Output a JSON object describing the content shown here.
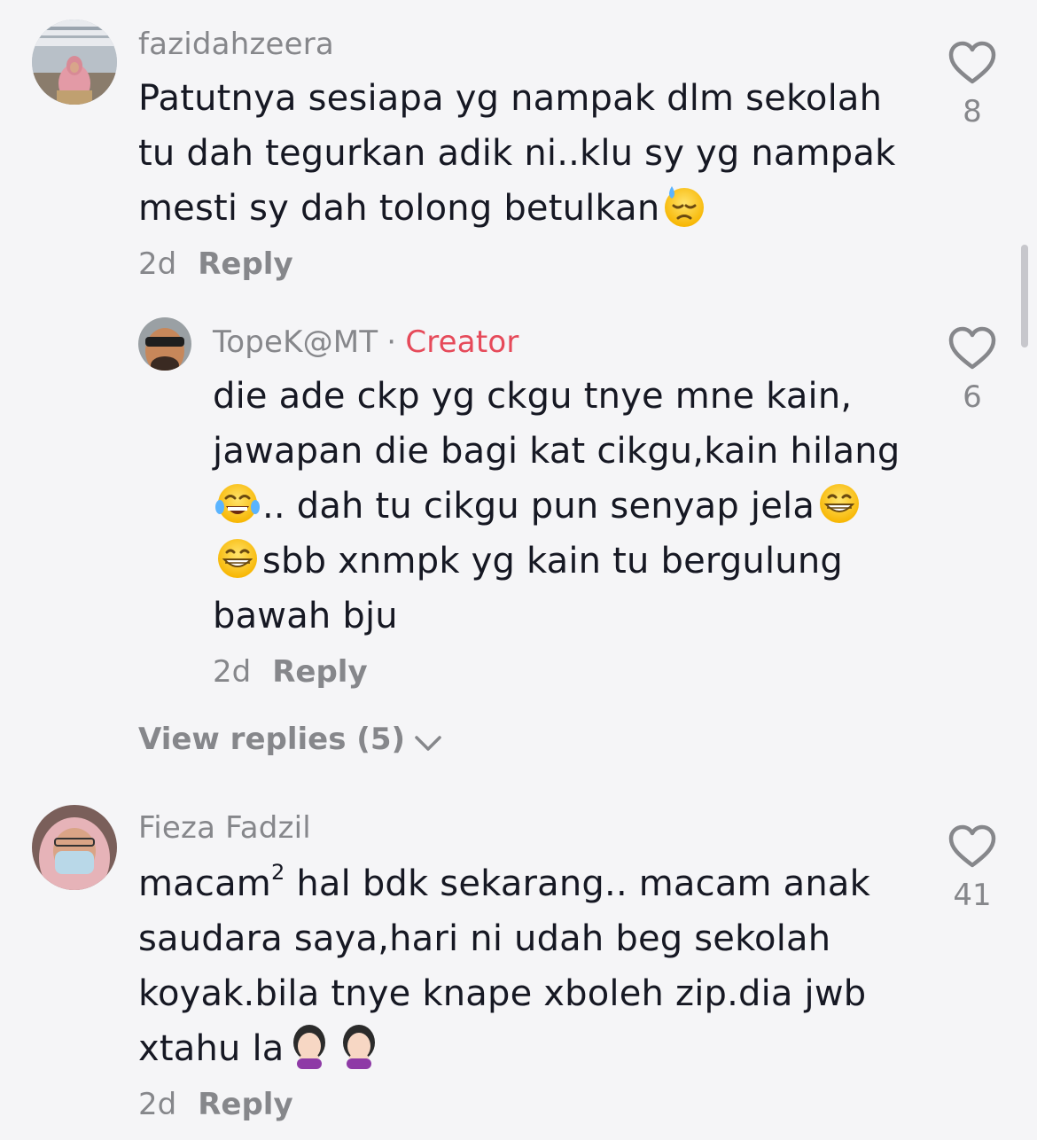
{
  "comments": [
    {
      "username": "fazidahzeera",
      "lines": [
        "Patutnya sesiapa yg nampak dlm sekolah",
        "tu dah tegurkan adik ni..klu sy yg nampak",
        "mesti sy dah tolong betulkan"
      ],
      "time": "2d",
      "reply_label": "Reply",
      "likes": "8",
      "avatar_icon": "avatar-woman-hijab-pink"
    },
    {
      "username": "TopeK@MT",
      "separator": "·",
      "badge": "Creator",
      "lines": [
        "die ade ckp yg ckgu tnye mne kain,",
        "jawapan die bagi kat cikgu,kain hilang",
        ".. dah tu cikgu pun senyap jela",
        "sbb xnmpk yg kain tu bergulung",
        "bawah bju"
      ],
      "time": "2d",
      "reply_label": "Reply",
      "likes": "6",
      "avatar_icon": "avatar-man-sunglasses"
    },
    {
      "username": "Fieza Fadzil",
      "lines_a": "macam",
      "sup": "2",
      "lines_b": " hal bdk sekarang.. macam anak",
      "lines": [
        "saudara saya,hari ni udah beg sekolah",
        "koyak.bila tnye knape xboleh zip.dia jwb",
        "xtahu la"
      ],
      "time": "2d",
      "reply_label": "Reply",
      "likes": "41",
      "avatar_icon": "avatar-woman-mask"
    }
  ],
  "view_replies": "View replies (5)",
  "colors": {
    "background": "#f5f5f7",
    "text": "#161823",
    "muted": "#86878b",
    "creator": "#e64a5a"
  }
}
